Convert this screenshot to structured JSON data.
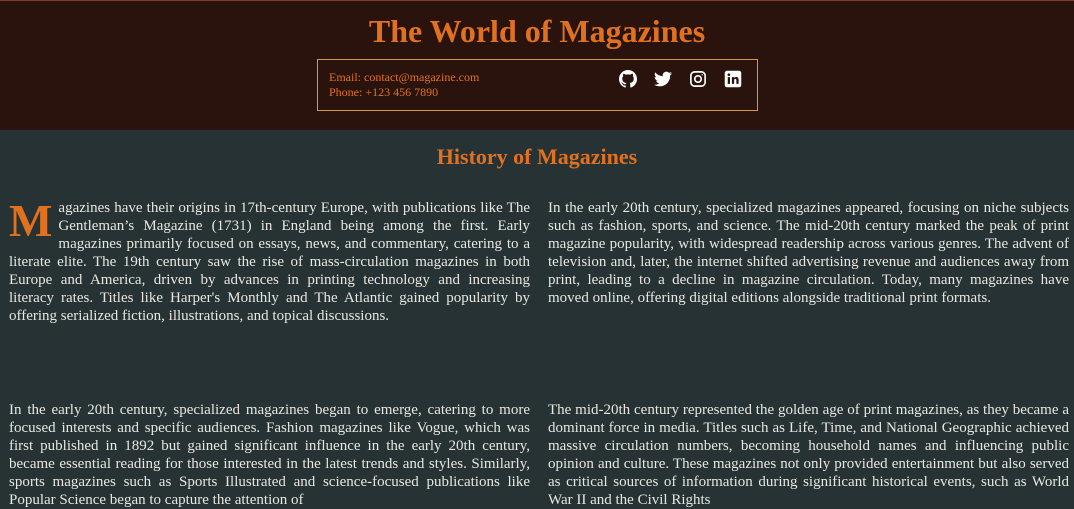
{
  "header": {
    "title": "The World of Magazines",
    "contact": {
      "email": "Email: contact@magazine.com",
      "phone": "Phone: +123 456 7890"
    },
    "social_icons": [
      "github-icon",
      "twitter-icon",
      "instagram-icon",
      "linkedin-icon"
    ]
  },
  "main": {
    "section_title": "History of Magazines",
    "paragraphs": [
      {
        "dropcap": "M",
        "text": "agazines have their origins in 17th-century Europe, with publications like The Gentleman’s Magazine (1731) in England being among the first. Early magazines primarily focused on essays, news, and commentary, catering to a literate elite. The 19th century saw the rise of mass-circulation magazines in both Europe and America, driven by advances in printing technology and increasing literacy rates. Titles like Harper's Monthly and The Atlantic gained popularity by offering serialized fiction, illustrations, and topical discussions."
      },
      {
        "text": "In the early 20th century, specialized magazines appeared, focusing on niche subjects such as fashion, sports, and science. The mid-20th century marked the peak of print magazine popularity, with widespread readership across various genres. The advent of television and, later, the internet shifted advertising revenue and audiences away from print, leading to a decline in magazine circulation. Today, many magazines have moved online, offering digital editions alongside traditional print formats."
      },
      {
        "text": "In the early 20th century, specialized magazines began to emerge, catering to more focused interests and specific audiences. Fashion magazines like Vogue, which was first published in 1892 but gained significant influence in the early 20th century, became essential reading for those interested in the latest trends and styles. Similarly, sports magazines such as Sports Illustrated and science-focused publications like Popular Science began to capture the attention of"
      },
      {
        "text": "The mid-20th century represented the golden age of print magazines, as they became a dominant force in media. Titles such as Life, Time, and National Geographic achieved massive circulation numbers, becoming household names and influencing public opinion and culture. These magazines not only provided entertainment but also served as critical sources of information during significant historical events, such as World War II and the Civil Rights"
      }
    ]
  },
  "colors": {
    "header_bg": "#2a130d",
    "body_bg": "#263234",
    "accent": "#e0711f",
    "border": "#d59a3e",
    "text": "#e8e6e0"
  }
}
